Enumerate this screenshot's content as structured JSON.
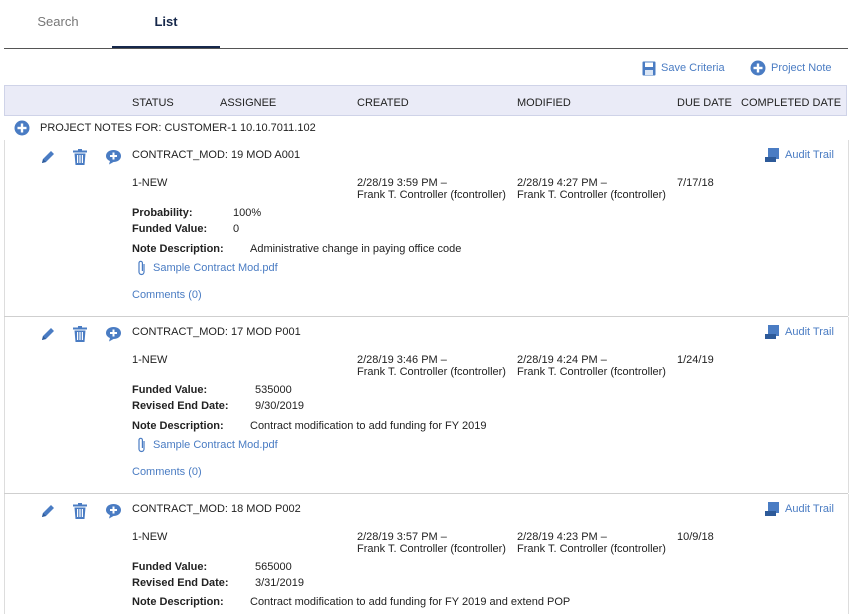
{
  "tabs": [
    {
      "label": "Search"
    },
    {
      "label": "List"
    }
  ],
  "toolbar": {
    "save_label": "Save Criteria",
    "project_note_label": "Project Note"
  },
  "columns": [
    "STATUS",
    "ASSIGNEE",
    "CREATED",
    "MODIFIED",
    "DUE DATE",
    "COMPLETED DATE"
  ],
  "project_notes_label": "PROJECT NOTES FOR:  CUSTOMER-1 10.10.7011.102",
  "audit_trail_label": "Audit Trail",
  "notes": [
    {
      "title": "CONTRACT_MOD: 19 MOD A001",
      "status": "1-NEW",
      "created_time": "2/28/19 3:59 PM –",
      "created_by": "Frank T. Controller (fcontroller)",
      "modified_time": "2/28/19 4:27 PM –",
      "modified_by": "Frank T. Controller (fcontroller)",
      "due": "7/17/18",
      "fields": [
        {
          "label": "Probability:",
          "value": "100%"
        },
        {
          "label": "Funded Value:",
          "value": "0"
        }
      ],
      "desc_label": "Note Description:",
      "desc": "Administrative change in paying office code",
      "attachment": "Sample Contract Mod.pdf",
      "comments": "Comments (0)"
    },
    {
      "title": "CONTRACT_MOD: 17 MOD P001",
      "status": "1-NEW",
      "created_time": "2/28/19 3:46 PM –",
      "created_by": "Frank T. Controller (fcontroller)",
      "modified_time": "2/28/19 4:24 PM –",
      "modified_by": "Frank T. Controller (fcontroller)",
      "due": "1/24/19",
      "fields": [
        {
          "label": "Funded Value:",
          "value": "535000"
        },
        {
          "label": "Revised End Date:",
          "value": "9/30/2019"
        }
      ],
      "desc_label": "Note Description:",
      "desc": "Contract modification to add funding for FY 2019",
      "attachment": "Sample Contract Mod.pdf",
      "comments": "Comments (0)"
    },
    {
      "title": "CONTRACT_MOD: 18 MOD P002",
      "status": "1-NEW",
      "created_time": "2/28/19 3:57 PM –",
      "created_by": "Frank T. Controller (fcontroller)",
      "modified_time": "2/28/19 4:23 PM –",
      "modified_by": "Frank T. Controller (fcontroller)",
      "due": "10/9/18",
      "fields": [
        {
          "label": "Funded Value:",
          "value": "565000"
        },
        {
          "label": "Revised End Date:",
          "value": "3/31/2019"
        }
      ],
      "desc_label": "Note Description:",
      "desc": "Contract modification to add funding for FY 2019 and extend POP",
      "attachment": "",
      "comments": ""
    }
  ],
  "colors": {
    "accent": "#4a7cc3",
    "tab_active": "#16284b",
    "header_bg": "#eaebf7"
  }
}
